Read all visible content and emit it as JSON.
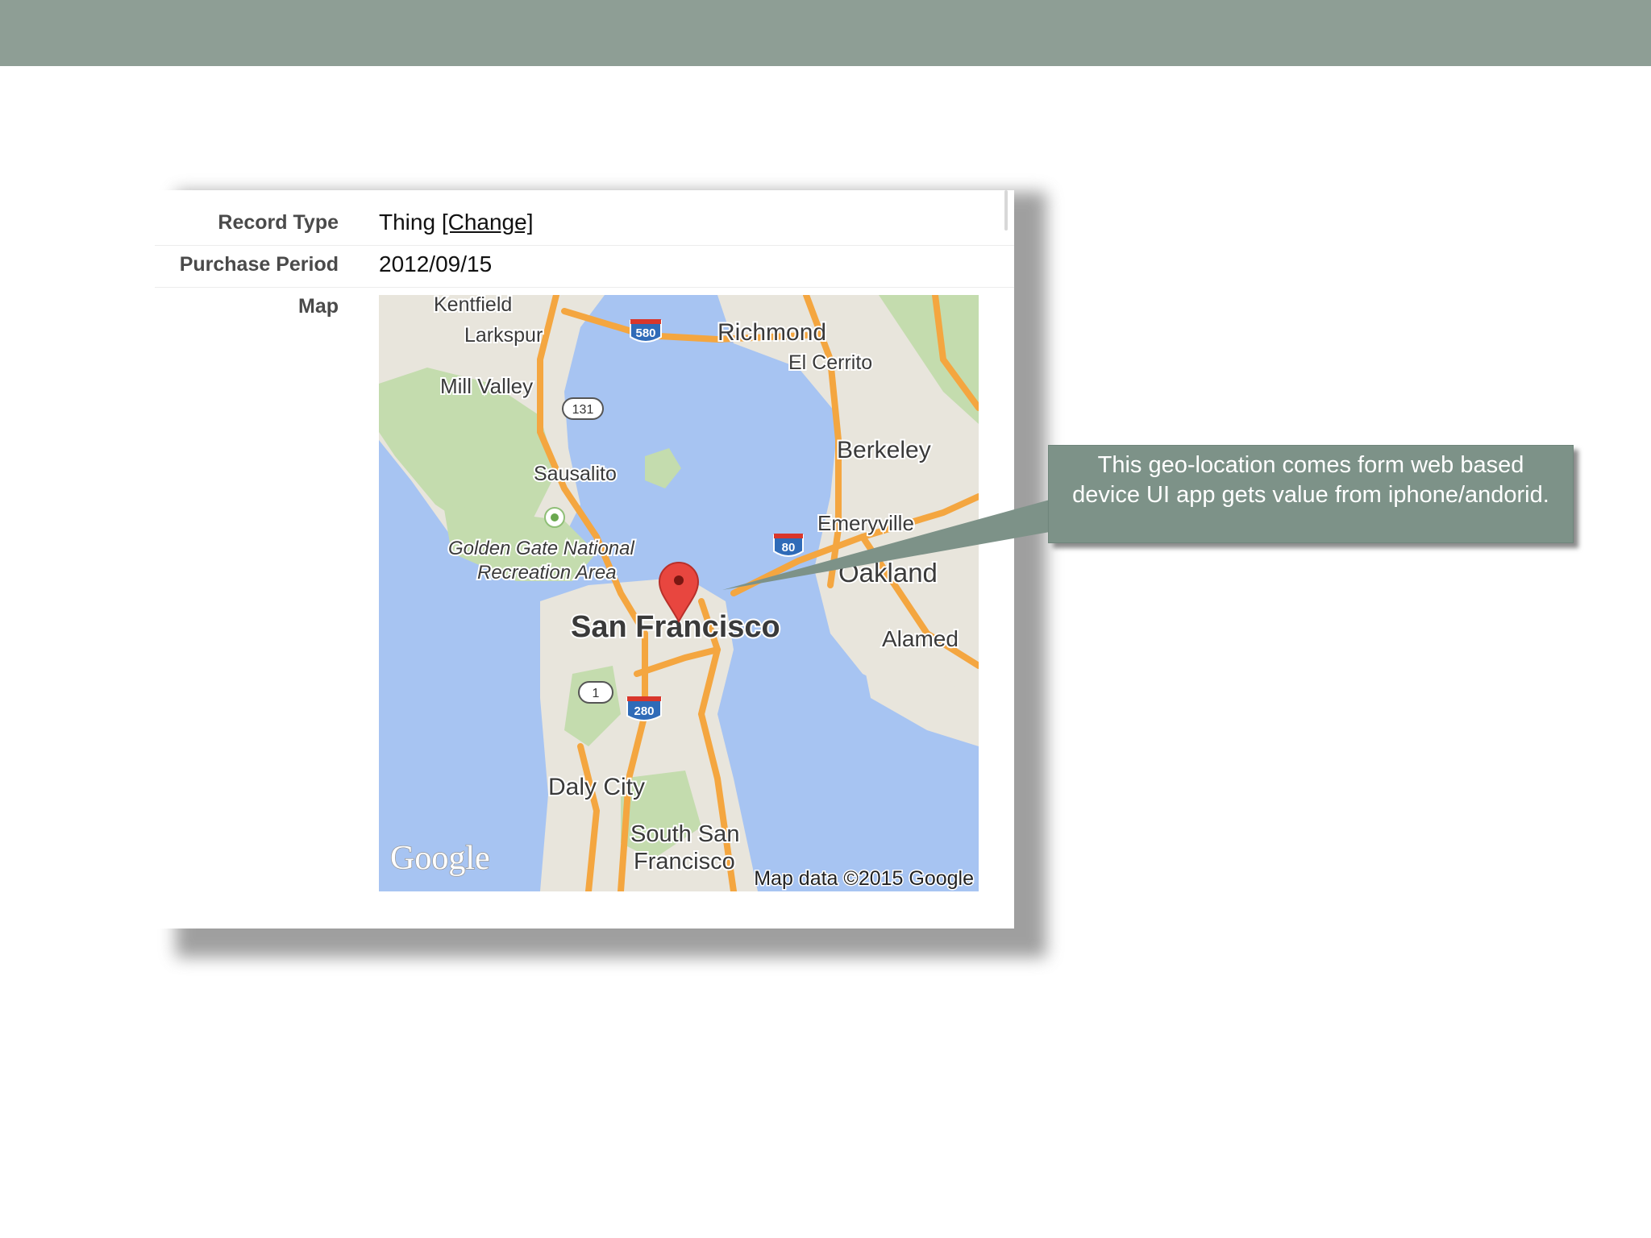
{
  "form": {
    "rows": [
      {
        "label": "Record Type",
        "value": "Thing",
        "link": "[Change]"
      },
      {
        "label": "Purchase Period",
        "value": "2012/09/15"
      },
      {
        "label": "Map"
      }
    ]
  },
  "map": {
    "labels": {
      "kentfield": "Kentfield",
      "larkspur": "Larkspur",
      "mill_valley": "Mill Valley",
      "sausalito": "Sausalito",
      "golden_gate_1": "Golden Gate National",
      "golden_gate_2": "Recreation Area",
      "richmond": "Richmond",
      "el_cerrito": "El Cerrito",
      "berkeley": "Berkeley",
      "emeryville": "Emeryville",
      "oakland": "Oakland",
      "alameda": "Alamed",
      "san_francisco": "San Francisco",
      "daly_city": "Daly City",
      "south_san_1": "South San",
      "south_san_2": "Francisco"
    },
    "shields": {
      "i580": "580",
      "r131": "131",
      "i80": "80",
      "r1": "1",
      "i280": "280"
    },
    "logo": "Google",
    "attribution": "Map data ©2015 Google",
    "colors": {
      "water": "#a7c4f2",
      "land": "#e8e5dc",
      "park": "#c4dcae",
      "road": "#f4a640",
      "pin": "#e8463f"
    }
  },
  "callout": {
    "text": "This geo-location comes form web based device UI app gets value from iphone/andorid."
  }
}
